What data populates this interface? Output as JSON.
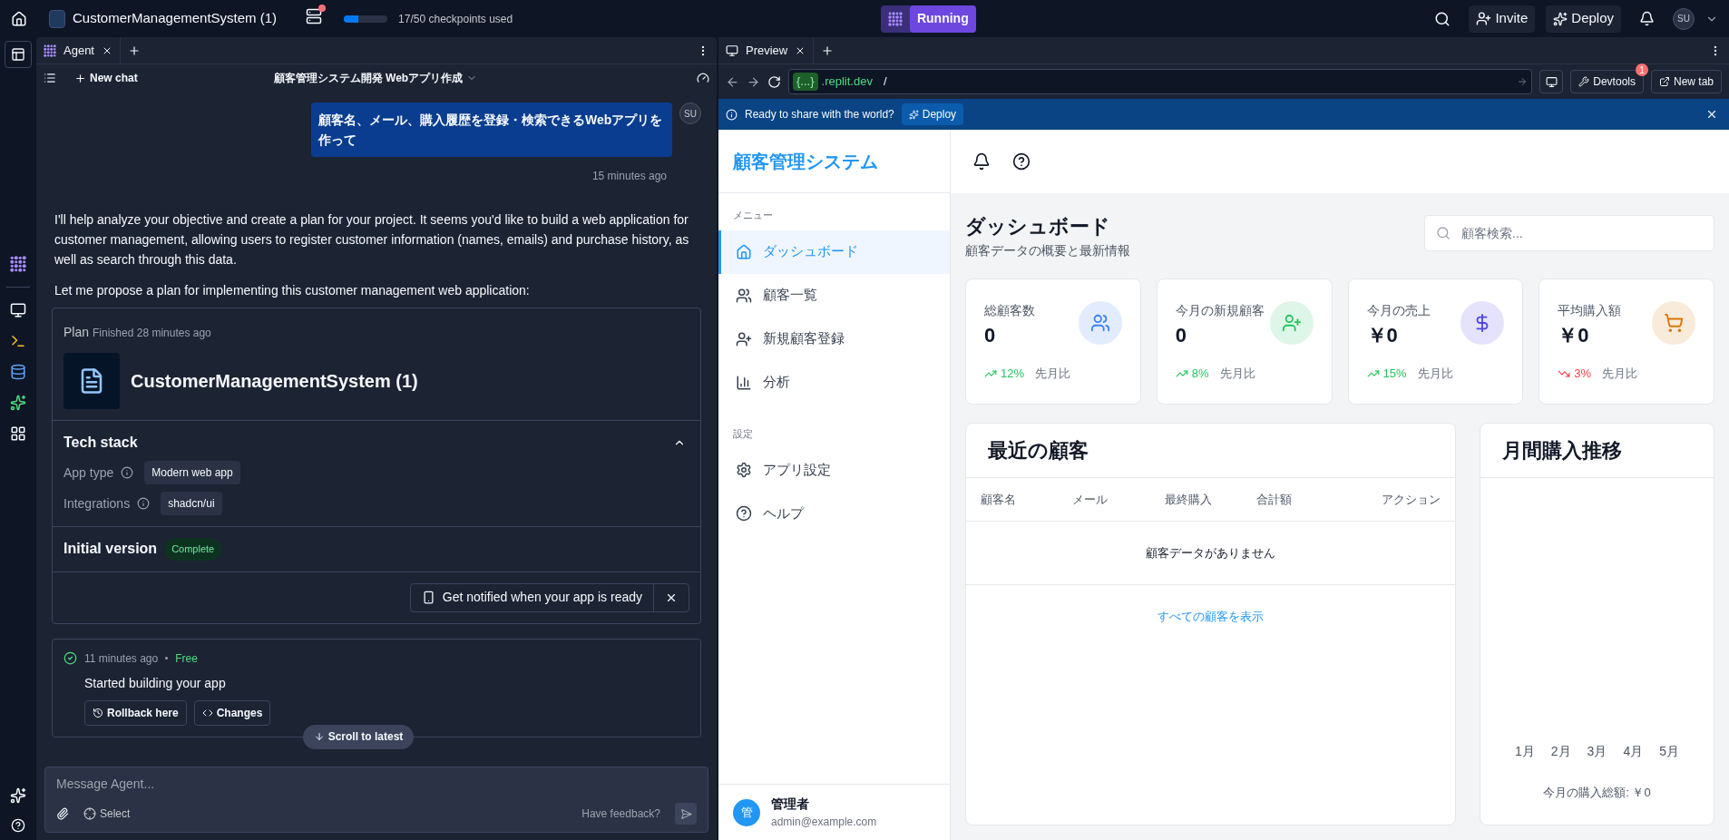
{
  "top_bar": {
    "project_name": "CustomerManagementSystem (1)",
    "checkpoints": {
      "text": "17/50 checkpoints used",
      "level": 0.34
    },
    "status": "Running",
    "invite": "Invite",
    "deploy": "Deploy",
    "avatar": "SU"
  },
  "agent": {
    "tab": "Agent",
    "new_chat": "New chat",
    "chat_title": "顧客管理システム開発 Webアプリ作成",
    "user_message": {
      "text": "顧客名、メール、購入履歴を登録・検索できるWebアプリを作って",
      "avatar": "SU",
      "time": "15 minutes ago"
    },
    "paragraphs": [
      "I'll help analyze your objective and create a plan for your project. It seems you'd like to build a web application for customer management, allowing users to register customer information (names, emails) and purchase history, as well as search through this data.",
      "Let me propose a plan for implementing this customer management web application:"
    ],
    "plan": {
      "label": "Plan",
      "finished": "Finished 28 minutes ago",
      "app_name": "CustomerManagementSystem (1)",
      "tech_stack": "Tech stack",
      "expanded": true,
      "rows": [
        {
          "label": "App type",
          "value": "Modern web app"
        },
        {
          "label": "Integrations",
          "value": "shadcn/ui"
        }
      ],
      "initial_version": "Initial version",
      "status": "Complete",
      "notify": "Get notified when your app is ready"
    },
    "checkpoint": {
      "time": "11 minutes ago",
      "tag": "Free",
      "text": "Started building your app",
      "buttons": [
        "Rollback here",
        "Changes"
      ]
    },
    "scroll_button": "Scroll to latest",
    "input": {
      "placeholder": "Message Agent...",
      "select": "Select",
      "feedback": "Have feedback?"
    }
  },
  "preview": {
    "tab": "Preview",
    "url_badge": "{...}",
    "url_host": ".replit.dev",
    "url_path": "/",
    "devtools": "Devtools",
    "devtools_badge": "1",
    "new_tab": "New tab",
    "banner": {
      "text": "Ready to share with the world?",
      "button": "Deploy"
    }
  },
  "app": {
    "brand": "顧客管理システム",
    "sections": [
      {
        "heading": "メニュー",
        "items": [
          {
            "label": "ダッシュボード",
            "selected": true
          },
          {
            "label": "顧客一覧",
            "selected": false
          },
          {
            "label": "新規顧客登録",
            "selected": false
          },
          {
            "label": "分析",
            "selected": false
          }
        ]
      },
      {
        "heading": "設定",
        "items": [
          {
            "label": "アプリ設定",
            "selected": false
          },
          {
            "label": "ヘルプ",
            "selected": false
          }
        ]
      }
    ],
    "user": {
      "avatar": "管",
      "name": "管理者",
      "email": "admin@example.com"
    },
    "title": "ダッシュボード",
    "subtitle": "顧客データの概要と最新情報",
    "search_placeholder": "顧客検索...",
    "stats": [
      {
        "label": "総顧客数",
        "value": "0",
        "change": "12%",
        "declining": false,
        "note": "先月比",
        "color": "#3b82f6"
      },
      {
        "label": "今月の新規顧客",
        "value": "0",
        "change": "8%",
        "declining": false,
        "note": "先月比",
        "color": "#22c55e"
      },
      {
        "label": "今月の売上",
        "value": "￥0",
        "change": "15%",
        "declining": false,
        "note": "先月比",
        "color": "#4f46e5"
      },
      {
        "label": "平均購入額",
        "value": "￥0",
        "change": "3%",
        "declining": true,
        "note": "先月比",
        "color": "#d97706"
      }
    ],
    "recent": {
      "title": "最近の顧客",
      "columns": [
        "顧客名",
        "メール",
        "最終購入",
        "合計額",
        "アクション"
      ],
      "empty": "顧客データがありません",
      "link": "すべての顧客を表示"
    },
    "monthly": {
      "title": "月間購入推移",
      "months": [
        "1月",
        "2月",
        "3月",
        "4月",
        "5月"
      ],
      "total": "今月の購入総額: ￥0"
    }
  }
}
